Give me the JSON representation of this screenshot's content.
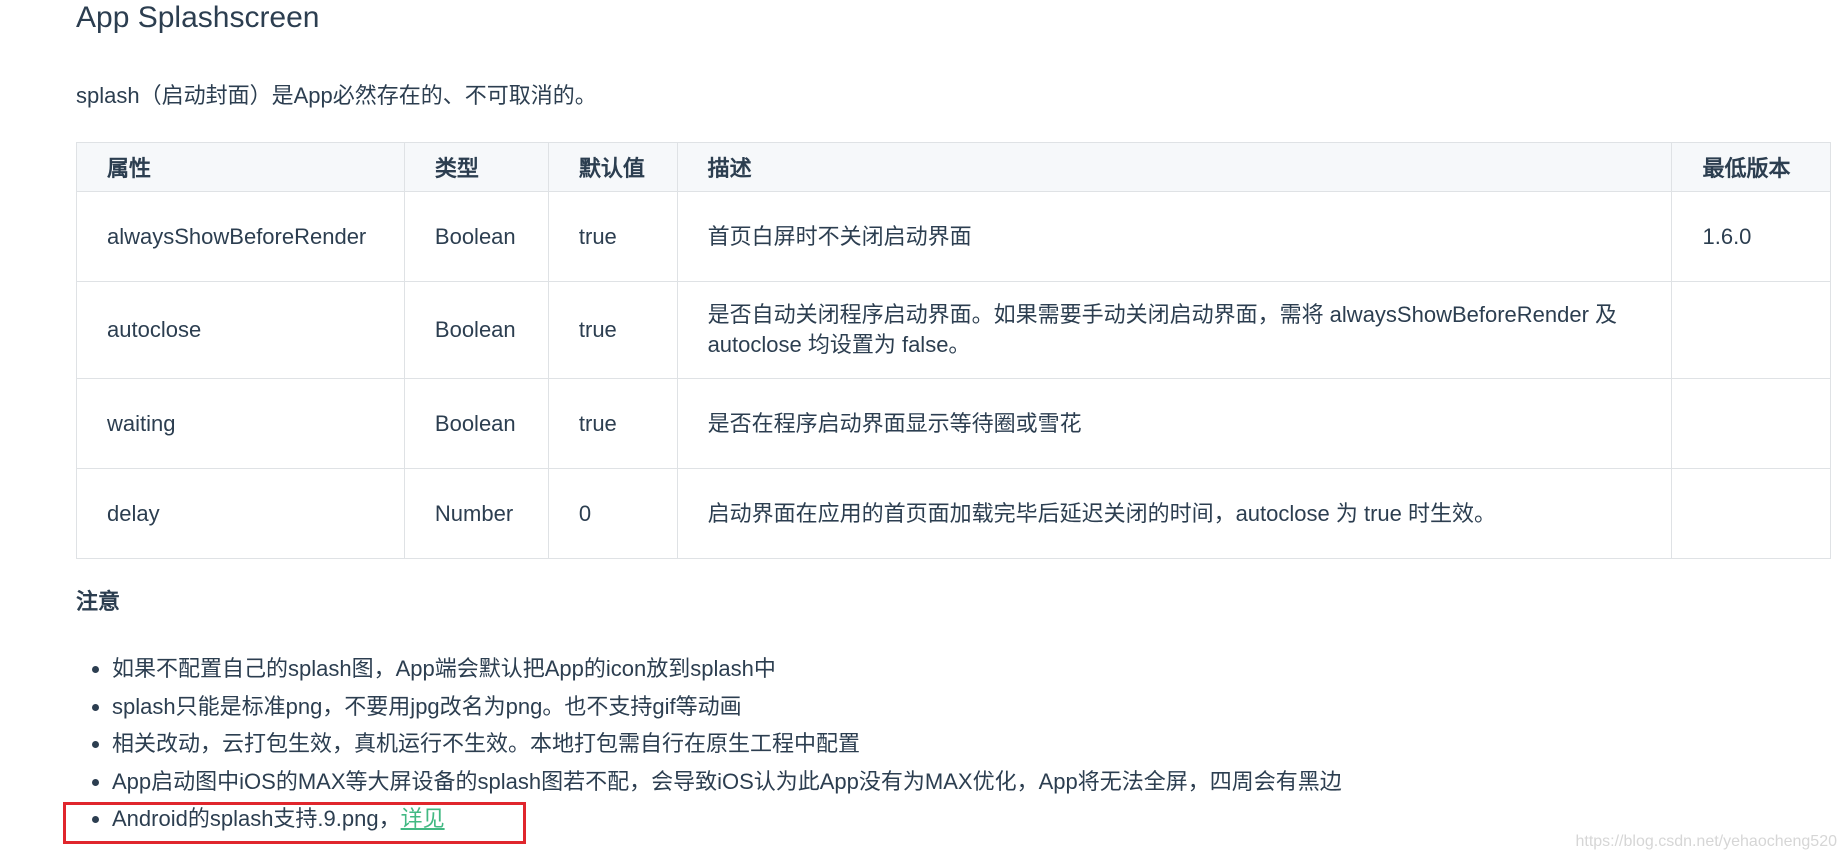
{
  "page": {
    "title": "App Splashscreen",
    "intro": "splash（启动封面）是App必然存在的、不可取消的。"
  },
  "table": {
    "headers": [
      "属性",
      "类型",
      "默认值",
      "描述",
      "最低版本"
    ],
    "rows": [
      [
        "alwaysShowBeforeRender",
        "Boolean",
        "true",
        "首页白屏时不关闭启动界面",
        "1.6.0"
      ],
      [
        "autoclose",
        "Boolean",
        "true",
        "是否自动关闭程序启动界面。如果需要手动关闭启动界面，需将 alwaysShowBeforeRender 及 autoclose 均设置为 false。",
        ""
      ],
      [
        "waiting",
        "Boolean",
        "true",
        "是否在程序启动界面显示等待圈或雪花",
        ""
      ],
      [
        "delay",
        "Number",
        "0",
        "启动界面在应用的首页面加载完毕后延迟关闭的时间，autoclose 为 true 时生效。",
        ""
      ]
    ]
  },
  "notes": {
    "heading": "注意",
    "items": [
      "如果不配置自己的splash图，App端会默认把App的icon放到splash中",
      "splash只能是标准png，不要用jpg改名为png。也不支持gif等动画",
      "相关改动，云打包生效，真机运行不生效。本地打包需自行在原生工程中配置",
      "App启动图中iOS的MAX等大屏设备的splash图若不配，会导致iOS认为此App没有为MAX优化，App将无法全屏，四周会有黑边"
    ],
    "last_item_text": "Android的splash支持.9.png，",
    "last_item_link": "详见"
  },
  "watermark": "https://blog.csdn.net/yehaocheng520",
  "colors": {
    "text": "#2c3e50",
    "link": "#42b983",
    "highlight_border": "#e0262d",
    "header_bg": "#f6f8fa"
  }
}
